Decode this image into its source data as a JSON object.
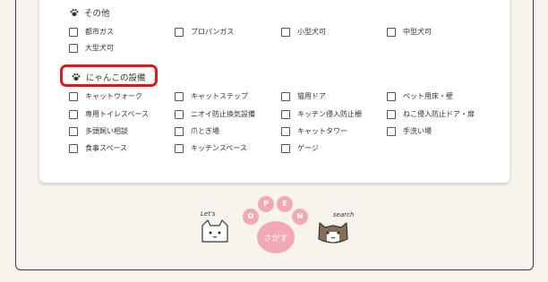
{
  "sections": {
    "other": {
      "title": "その他",
      "items": [
        "都市ガス",
        "プロパンガス",
        "小型犬可",
        "中型犬可",
        "大型犬可"
      ]
    },
    "cat": {
      "title": "にゃんこの設備",
      "items": [
        "キャットウォーク",
        "キャットステップ",
        "猫用ドア",
        "ペット用床・壁",
        "専用トイレスペース",
        "ニオイ防止換気設備",
        "キッチン侵入防止柵",
        "ねこ侵入防止ドア・扉",
        "多頭飼い相談",
        "爪とぎ場",
        "キャットタワー",
        "手洗い場",
        "食事スペース",
        "キッチンスペース",
        "ゲージ"
      ]
    }
  },
  "search_button": {
    "letters": [
      "O",
      "P",
      "E",
      "N"
    ],
    "label": "さがす",
    "lets": "Let's",
    "search": "search"
  },
  "colors": {
    "highlight": "#e0171d",
    "paw_pink": "#f2a9b6"
  }
}
